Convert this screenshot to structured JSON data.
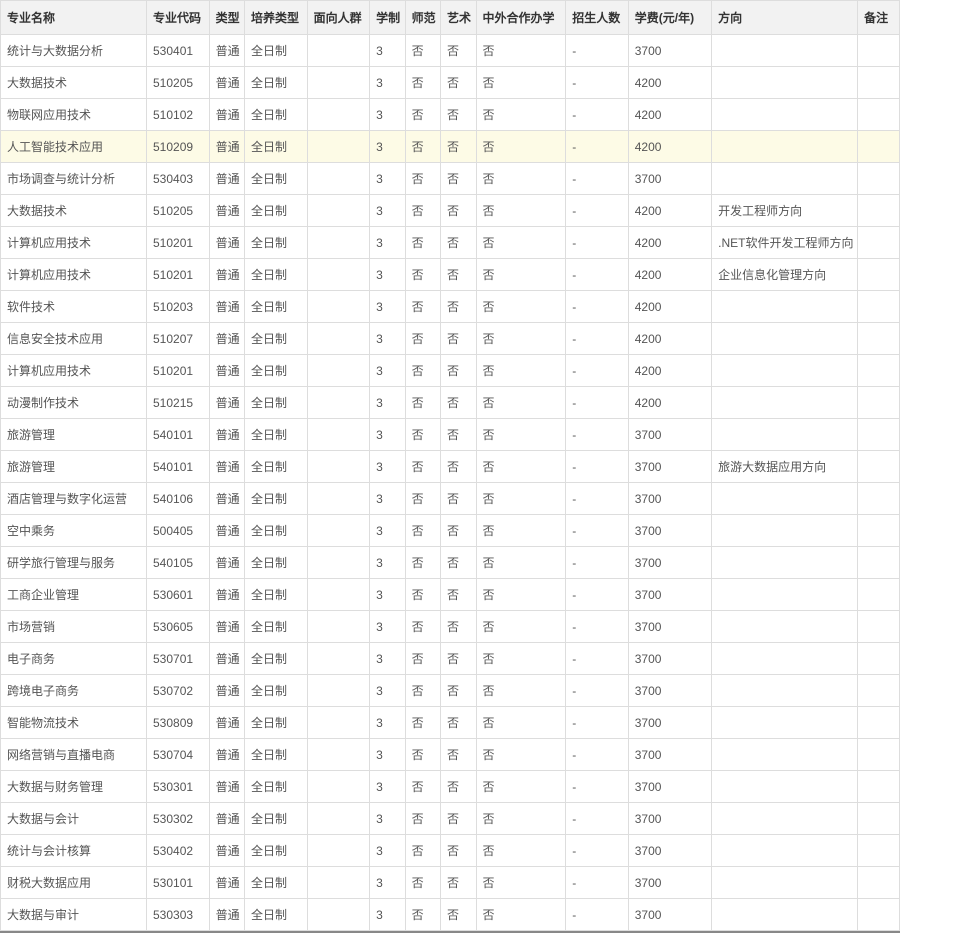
{
  "headers": {
    "name": "专业名称",
    "code": "专业代码",
    "type": "类型",
    "train": "培养类型",
    "target": "面向人群",
    "years": "学制",
    "normal": "师范",
    "art": "艺术",
    "coop": "中外合作办学",
    "enroll": "招生人数",
    "fee": "学费(元/年)",
    "direction": "方向",
    "remark": "备注"
  },
  "rows": [
    {
      "name": "统计与大数据分析",
      "code": "530401",
      "type": "普通",
      "train": "全日制",
      "target": "",
      "years": "3",
      "normal": "否",
      "art": "否",
      "coop": "否",
      "enroll": "-",
      "fee": "3700",
      "direction": "",
      "remark": "",
      "highlight": false
    },
    {
      "name": "大数据技术",
      "code": "510205",
      "type": "普通",
      "train": "全日制",
      "target": "",
      "years": "3",
      "normal": "否",
      "art": "否",
      "coop": "否",
      "enroll": "-",
      "fee": "4200",
      "direction": "",
      "remark": "",
      "highlight": false
    },
    {
      "name": "物联网应用技术",
      "code": "510102",
      "type": "普通",
      "train": "全日制",
      "target": "",
      "years": "3",
      "normal": "否",
      "art": "否",
      "coop": "否",
      "enroll": "-",
      "fee": "4200",
      "direction": "",
      "remark": "",
      "highlight": false
    },
    {
      "name": "人工智能技术应用",
      "code": "510209",
      "type": "普通",
      "train": "全日制",
      "target": "",
      "years": "3",
      "normal": "否",
      "art": "否",
      "coop": "否",
      "enroll": "-",
      "fee": "4200",
      "direction": "",
      "remark": "",
      "highlight": true
    },
    {
      "name": "市场调查与统计分析",
      "code": "530403",
      "type": "普通",
      "train": "全日制",
      "target": "",
      "years": "3",
      "normal": "否",
      "art": "否",
      "coop": "否",
      "enroll": "-",
      "fee": "3700",
      "direction": "",
      "remark": "",
      "highlight": false
    },
    {
      "name": "大数据技术",
      "code": "510205",
      "type": "普通",
      "train": "全日制",
      "target": "",
      "years": "3",
      "normal": "否",
      "art": "否",
      "coop": "否",
      "enroll": "-",
      "fee": "4200",
      "direction": "开发工程师方向",
      "remark": "",
      "highlight": false
    },
    {
      "name": "计算机应用技术",
      "code": "510201",
      "type": "普通",
      "train": "全日制",
      "target": "",
      "years": "3",
      "normal": "否",
      "art": "否",
      "coop": "否",
      "enroll": "-",
      "fee": "4200",
      "direction": ".NET软件开发工程师方向",
      "remark": "",
      "highlight": false
    },
    {
      "name": "计算机应用技术",
      "code": "510201",
      "type": "普通",
      "train": "全日制",
      "target": "",
      "years": "3",
      "normal": "否",
      "art": "否",
      "coop": "否",
      "enroll": "-",
      "fee": "4200",
      "direction": "企业信息化管理方向",
      "remark": "",
      "highlight": false
    },
    {
      "name": "软件技术",
      "code": "510203",
      "type": "普通",
      "train": "全日制",
      "target": "",
      "years": "3",
      "normal": "否",
      "art": "否",
      "coop": "否",
      "enroll": "-",
      "fee": "4200",
      "direction": "",
      "remark": "",
      "highlight": false
    },
    {
      "name": "信息安全技术应用",
      "code": "510207",
      "type": "普通",
      "train": "全日制",
      "target": "",
      "years": "3",
      "normal": "否",
      "art": "否",
      "coop": "否",
      "enroll": "-",
      "fee": "4200",
      "direction": "",
      "remark": "",
      "highlight": false
    },
    {
      "name": "计算机应用技术",
      "code": "510201",
      "type": "普通",
      "train": "全日制",
      "target": "",
      "years": "3",
      "normal": "否",
      "art": "否",
      "coop": "否",
      "enroll": "-",
      "fee": "4200",
      "direction": "",
      "remark": "",
      "highlight": false
    },
    {
      "name": "动漫制作技术",
      "code": "510215",
      "type": "普通",
      "train": "全日制",
      "target": "",
      "years": "3",
      "normal": "否",
      "art": "否",
      "coop": "否",
      "enroll": "-",
      "fee": "4200",
      "direction": "",
      "remark": "",
      "highlight": false
    },
    {
      "name": "旅游管理",
      "code": "540101",
      "type": "普通",
      "train": "全日制",
      "target": "",
      "years": "3",
      "normal": "否",
      "art": "否",
      "coop": "否",
      "enroll": "-",
      "fee": "3700",
      "direction": "",
      "remark": "",
      "highlight": false
    },
    {
      "name": "旅游管理",
      "code": "540101",
      "type": "普通",
      "train": "全日制",
      "target": "",
      "years": "3",
      "normal": "否",
      "art": "否",
      "coop": "否",
      "enroll": "-",
      "fee": "3700",
      "direction": "旅游大数据应用方向",
      "remark": "",
      "highlight": false
    },
    {
      "name": "酒店管理与数字化运营",
      "code": "540106",
      "type": "普通",
      "train": "全日制",
      "target": "",
      "years": "3",
      "normal": "否",
      "art": "否",
      "coop": "否",
      "enroll": "-",
      "fee": "3700",
      "direction": "",
      "remark": "",
      "highlight": false
    },
    {
      "name": "空中乘务",
      "code": "500405",
      "type": "普通",
      "train": "全日制",
      "target": "",
      "years": "3",
      "normal": "否",
      "art": "否",
      "coop": "否",
      "enroll": "-",
      "fee": "3700",
      "direction": "",
      "remark": "",
      "highlight": false
    },
    {
      "name": "研学旅行管理与服务",
      "code": "540105",
      "type": "普通",
      "train": "全日制",
      "target": "",
      "years": "3",
      "normal": "否",
      "art": "否",
      "coop": "否",
      "enroll": "-",
      "fee": "3700",
      "direction": "",
      "remark": "",
      "highlight": false
    },
    {
      "name": "工商企业管理",
      "code": "530601",
      "type": "普通",
      "train": "全日制",
      "target": "",
      "years": "3",
      "normal": "否",
      "art": "否",
      "coop": "否",
      "enroll": "-",
      "fee": "3700",
      "direction": "",
      "remark": "",
      "highlight": false
    },
    {
      "name": "市场营销",
      "code": "530605",
      "type": "普通",
      "train": "全日制",
      "target": "",
      "years": "3",
      "normal": "否",
      "art": "否",
      "coop": "否",
      "enroll": "-",
      "fee": "3700",
      "direction": "",
      "remark": "",
      "highlight": false
    },
    {
      "name": "电子商务",
      "code": "530701",
      "type": "普通",
      "train": "全日制",
      "target": "",
      "years": "3",
      "normal": "否",
      "art": "否",
      "coop": "否",
      "enroll": "-",
      "fee": "3700",
      "direction": "",
      "remark": "",
      "highlight": false
    },
    {
      "name": "跨境电子商务",
      "code": "530702",
      "type": "普通",
      "train": "全日制",
      "target": "",
      "years": "3",
      "normal": "否",
      "art": "否",
      "coop": "否",
      "enroll": "-",
      "fee": "3700",
      "direction": "",
      "remark": "",
      "highlight": false
    },
    {
      "name": "智能物流技术",
      "code": "530809",
      "type": "普通",
      "train": "全日制",
      "target": "",
      "years": "3",
      "normal": "否",
      "art": "否",
      "coop": "否",
      "enroll": "-",
      "fee": "3700",
      "direction": "",
      "remark": "",
      "highlight": false
    },
    {
      "name": "网络营销与直播电商",
      "code": "530704",
      "type": "普通",
      "train": "全日制",
      "target": "",
      "years": "3",
      "normal": "否",
      "art": "否",
      "coop": "否",
      "enroll": "-",
      "fee": "3700",
      "direction": "",
      "remark": "",
      "highlight": false
    },
    {
      "name": "大数据与财务管理",
      "code": "530301",
      "type": "普通",
      "train": "全日制",
      "target": "",
      "years": "3",
      "normal": "否",
      "art": "否",
      "coop": "否",
      "enroll": "-",
      "fee": "3700",
      "direction": "",
      "remark": "",
      "highlight": false
    },
    {
      "name": "大数据与会计",
      "code": "530302",
      "type": "普通",
      "train": "全日制",
      "target": "",
      "years": "3",
      "normal": "否",
      "art": "否",
      "coop": "否",
      "enroll": "-",
      "fee": "3700",
      "direction": "",
      "remark": "",
      "highlight": false
    },
    {
      "name": "统计与会计核算",
      "code": "530402",
      "type": "普通",
      "train": "全日制",
      "target": "",
      "years": "3",
      "normal": "否",
      "art": "否",
      "coop": "否",
      "enroll": "-",
      "fee": "3700",
      "direction": "",
      "remark": "",
      "highlight": false
    },
    {
      "name": "财税大数据应用",
      "code": "530101",
      "type": "普通",
      "train": "全日制",
      "target": "",
      "years": "3",
      "normal": "否",
      "art": "否",
      "coop": "否",
      "enroll": "-",
      "fee": "3700",
      "direction": "",
      "remark": "",
      "highlight": false
    },
    {
      "name": "大数据与审计",
      "code": "530303",
      "type": "普通",
      "train": "全日制",
      "target": "",
      "years": "3",
      "normal": "否",
      "art": "否",
      "coop": "否",
      "enroll": "-",
      "fee": "3700",
      "direction": "",
      "remark": "",
      "highlight": false
    }
  ]
}
